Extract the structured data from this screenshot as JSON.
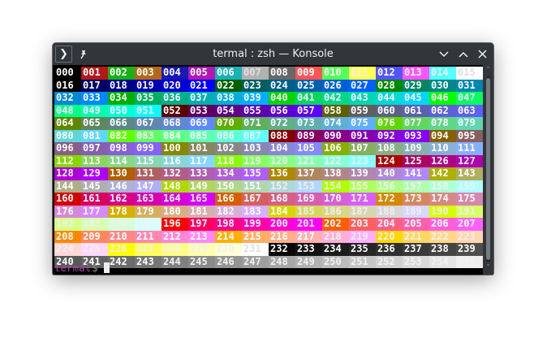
{
  "window": {
    "title": "termal : zsh — Konsole",
    "menu_icon": "menu-icon",
    "pin_icon": "pin-icon",
    "minimize_icon": "chevron-down-icon",
    "maximize_icon": "chevron-up-icon",
    "close_icon": "close-icon"
  },
  "terminal": {
    "cells": [
      "000",
      "001",
      "002",
      "003",
      "004",
      "005",
      "006",
      "007",
      "008",
      "009",
      "010",
      "011",
      "012",
      "013",
      "014",
      "015",
      "016",
      "017",
      "018",
      "019",
      "020",
      "021",
      "022",
      "023",
      "024",
      "025",
      "026",
      "027",
      "028",
      "029",
      "030",
      "031",
      "032",
      "033",
      "034",
      "035",
      "036",
      "037",
      "038",
      "039",
      "040",
      "041",
      "042",
      "043",
      "044",
      "045",
      "046",
      "047",
      "048",
      "049",
      "050",
      "051",
      "052",
      "053",
      "054",
      "055",
      "056",
      "057",
      "058",
      "059",
      "060",
      "061",
      "062",
      "063",
      "064",
      "065",
      "066",
      "067",
      "068",
      "069",
      "070",
      "071",
      "072",
      "073",
      "074",
      "075",
      "076",
      "077",
      "078",
      "079",
      "080",
      "081",
      "082",
      "083",
      "084",
      "085",
      "086",
      "087",
      "088",
      "089",
      "090",
      "091",
      "092",
      "093",
      "094",
      "095",
      "096",
      "097",
      "098",
      "099",
      "100",
      "101",
      "102",
      "103",
      "104",
      "105",
      "106",
      "107",
      "108",
      "109",
      "110",
      "111",
      "112",
      "113",
      "114",
      "115",
      "116",
      "117",
      "118",
      "119",
      "120",
      "121",
      "122",
      "123",
      "124",
      "125",
      "126",
      "127",
      "128",
      "129",
      "130",
      "131",
      "132",
      "133",
      "134",
      "135",
      "136",
      "137",
      "138",
      "139",
      "140",
      "141",
      "142",
      "143",
      "144",
      "145",
      "146",
      "147",
      "148",
      "149",
      "150",
      "151",
      "152",
      "153",
      "154",
      "155",
      "156",
      "157",
      "158",
      "159",
      "160",
      "161",
      "162",
      "163",
      "164",
      "165",
      "166",
      "167",
      "168",
      "169",
      "170",
      "171",
      "172",
      "173",
      "174",
      "175",
      "176",
      "177",
      "178",
      "179",
      "180",
      "181",
      "182",
      "183",
      "184",
      "185",
      "186",
      "187",
      "188",
      "189",
      "190",
      "191",
      "192",
      "193",
      "194",
      "195",
      "196",
      "197",
      "198",
      "199",
      "200",
      "201",
      "202",
      "203",
      "204",
      "205",
      "206",
      "207",
      "208",
      "209",
      "210",
      "211",
      "212",
      "213",
      "214",
      "215",
      "216",
      "217",
      "218",
      "219",
      "220",
      "221",
      "222",
      "223",
      "224",
      "225",
      "226",
      "227",
      "228",
      "229",
      "230",
      "231",
      "232",
      "233",
      "234",
      "235",
      "236",
      "237",
      "238",
      "239",
      "240",
      "241",
      "242",
      "243",
      "244",
      "245",
      "246",
      "247",
      "248",
      "249",
      "250",
      "251",
      "252",
      "253",
      "254",
      "255"
    ],
    "prompt_user": "termal",
    "prompt_symbol": "$"
  },
  "colors": {
    "titlebar": "#31363b",
    "terminal_bg": "#000000",
    "prompt_user": "#b040b0"
  }
}
